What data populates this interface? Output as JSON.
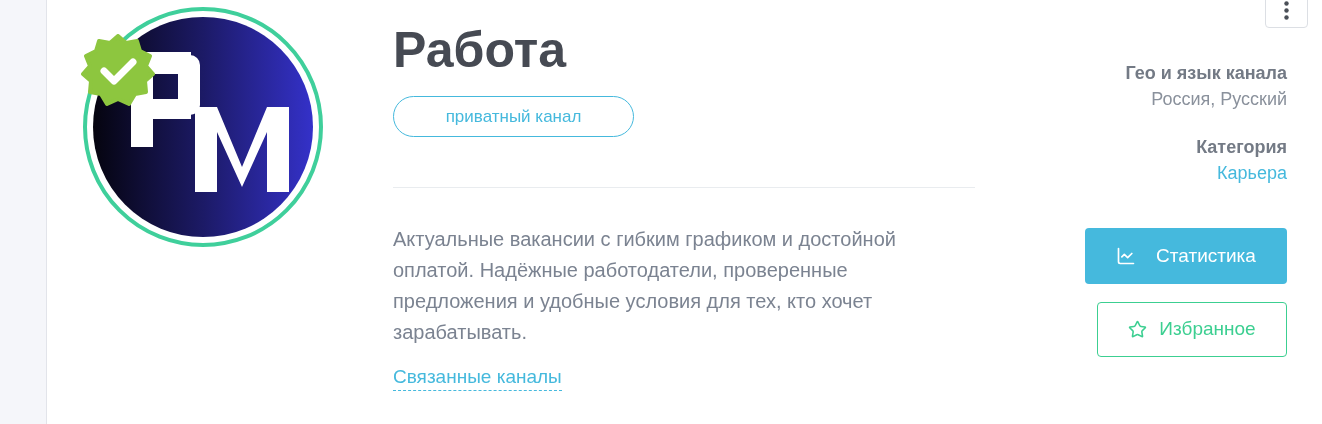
{
  "channel": {
    "avatar": {
      "kind": "picture",
      "verified": true
    },
    "title": "Работа",
    "privacy_badge": "приватный канал",
    "description": "Актуальные вакансии с гибким графиком и достойной оплатой. Надёжные работодатели, проверенные предложения и удобные условия для тех, кто хочет зарабатывать.",
    "related_link": "Связанные каналы"
  },
  "info": [
    {
      "label": "Гео и язык канала",
      "value": "Россия, Русский",
      "kind": "text"
    },
    {
      "label": "Категория",
      "value": "Карьера",
      "kind": "link"
    }
  ],
  "buttons": [
    {
      "label": "Статистика",
      "kind": "primary"
    },
    {
      "label": "Избранное",
      "kind": "outline"
    }
  ]
}
